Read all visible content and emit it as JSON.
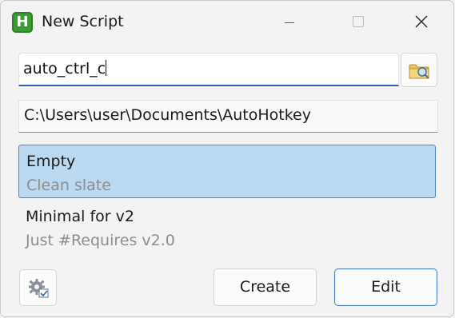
{
  "window": {
    "title": "New Script",
    "app_icon_letter": "H",
    "app_icon_color": "#3d9b35"
  },
  "name_input": {
    "value": "auto_ctrl_c"
  },
  "path_field": {
    "value": "C:\\Users\\user\\Documents\\AutoHotkey"
  },
  "templates": [
    {
      "name": "Empty",
      "description": "Clean slate",
      "selected": true
    },
    {
      "name": "Minimal for v2",
      "description": "Just #Requires v2.0",
      "selected": false
    }
  ],
  "buttons": {
    "create_label": "Create",
    "edit_label": "Edit"
  },
  "icons": {
    "browse": "folder-search-icon",
    "settings": "gear-settings-icon"
  },
  "colors": {
    "accent": "#2a63b7",
    "selection_bg": "#bcd9f2",
    "selection_border": "#4e86c6",
    "description_text": "#8d8d8d"
  }
}
